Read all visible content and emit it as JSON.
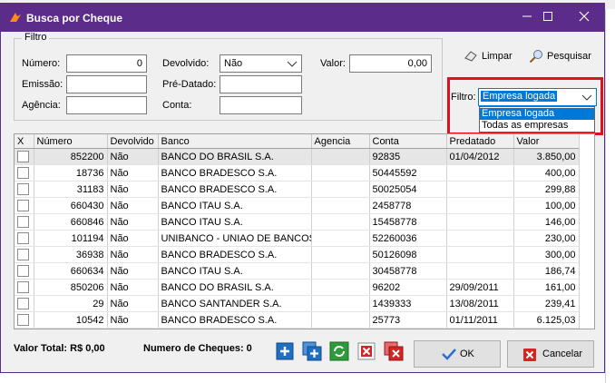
{
  "window": {
    "title": "Busca por Cheque",
    "minimize_label": "–",
    "maximize_label": "☐",
    "close_label": "✕"
  },
  "filter_group": {
    "legend": "Filtro",
    "numero_label": "Número:",
    "numero_value": "0",
    "emissao_label": "Emissão:",
    "emissao_value": "",
    "agencia_label": "Agência:",
    "agencia_value": "",
    "devolvido_label": "Devolvido:",
    "devolvido_value": "Não",
    "predatado_label": "Pré-Datado:",
    "predatado_value": "",
    "conta_label": "Conta:",
    "conta_value": "",
    "valor_label": "Valor:",
    "valor_value": "0,00"
  },
  "actions": {
    "limpar_label": "Limpar",
    "pesquisar_label": "Pesquisar"
  },
  "filtro_empresa": {
    "label": "Filtro:",
    "selected": "Empresa logada",
    "options": [
      "Empresa logada",
      "Todas as empresas"
    ]
  },
  "table": {
    "columns": [
      "X",
      "Número",
      "Devolvido",
      "Banco",
      "Agencia",
      "Conta",
      "Predatado",
      "Valor"
    ],
    "rows": [
      [
        "",
        "852200",
        "Não",
        "BANCO DO BRASIL S.A.",
        "",
        "92835",
        "01/04/2012",
        "3.850,00"
      ],
      [
        "",
        "18736",
        "Não",
        "BANCO BRADESCO S.A.",
        "",
        "50445592",
        "",
        "400,00"
      ],
      [
        "",
        "31183",
        "Não",
        "BANCO BRADESCO S.A.",
        "",
        "50025054",
        "",
        "299,88"
      ],
      [
        "",
        "660430",
        "Não",
        "BANCO ITAU S.A.",
        "",
        "2458778",
        "",
        "100,00"
      ],
      [
        "",
        "660846",
        "Não",
        "BANCO ITAU S.A.",
        "",
        "15458778",
        "",
        "146,00"
      ],
      [
        "",
        "101194",
        "Não",
        "UNIBANCO - UNIAO DE BANCOS B",
        "",
        "52260036",
        "",
        "230,00"
      ],
      [
        "",
        "36938",
        "Não",
        "BANCO BRADESCO S.A.",
        "",
        "50126098",
        "",
        "300,00"
      ],
      [
        "",
        "660634",
        "Não",
        "BANCO ITAU S.A.",
        "",
        "30458778",
        "",
        "186,74"
      ],
      [
        "",
        "850206",
        "Não",
        "BANCO DO BRASIL S.A.",
        "",
        "96202",
        "29/09/2011",
        "161,00"
      ],
      [
        "",
        "29",
        "Não",
        "BANCO SANTANDER S.A.",
        "",
        "1439333",
        "13/08/2011",
        "239,41"
      ],
      [
        "",
        "10542",
        "Não",
        "BANCO BRADESCO S.A.",
        "",
        "25773",
        "01/11/2011",
        "6.125,03"
      ]
    ]
  },
  "footer": {
    "valor_total": "Valor Total: R$ 0,00",
    "numero_cheques": "Numero de Cheques: 0",
    "ok_label": "OK",
    "cancelar_label": "Cancelar"
  },
  "icons": {
    "app": "bird-logo-icon",
    "limpar": "eraser-icon",
    "pesquisar": "magnifier-icon",
    "add": "add-icon",
    "add_multiple": "add-multiple-icon",
    "refresh": "refresh-icon",
    "delete": "delete-icon",
    "delete_multiple": "delete-multiple-icon",
    "ok": "checkmark-icon",
    "cancel": "cancel-icon"
  },
  "colors": {
    "titlebar": "#5b2c89",
    "highlight": "#e01020",
    "selection": "#0078d7"
  }
}
